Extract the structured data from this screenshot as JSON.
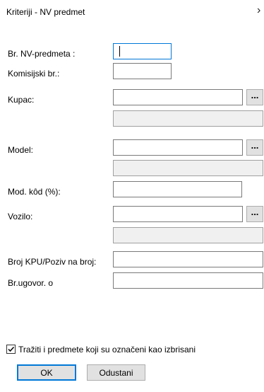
{
  "window": {
    "title": "Kriteriji - NV predmet",
    "close_icon": "close-icon"
  },
  "form": {
    "br_nv_predmeta": {
      "label": "Br. NV-predmeta :",
      "value": ""
    },
    "komisijski_br": {
      "label": "Komisijski br.:",
      "value": ""
    },
    "kupac": {
      "label": "Kupac:",
      "value": "",
      "extra_value": "",
      "browse_label": "..."
    },
    "model": {
      "label": "Model:",
      "value": "",
      "extra_value": "",
      "browse_label": "..."
    },
    "mod_kod": {
      "label": "Mod. kôd (%):",
      "value": ""
    },
    "vozilo": {
      "label": "Vozilo:",
      "value": "",
      "extra_value": "",
      "browse_label": "..."
    },
    "broj_kpu": {
      "label": "Broj KPU/Poziv na broj:",
      "value": ""
    },
    "br_ugovor": {
      "label": "Br.ugovor. o",
      "value": ""
    }
  },
  "options": {
    "include_deleted": {
      "label": "Tražiti i predmete koji su označeni kao izbrisani",
      "checked": true
    }
  },
  "buttons": {
    "ok": "OK",
    "cancel": "Odustani"
  }
}
